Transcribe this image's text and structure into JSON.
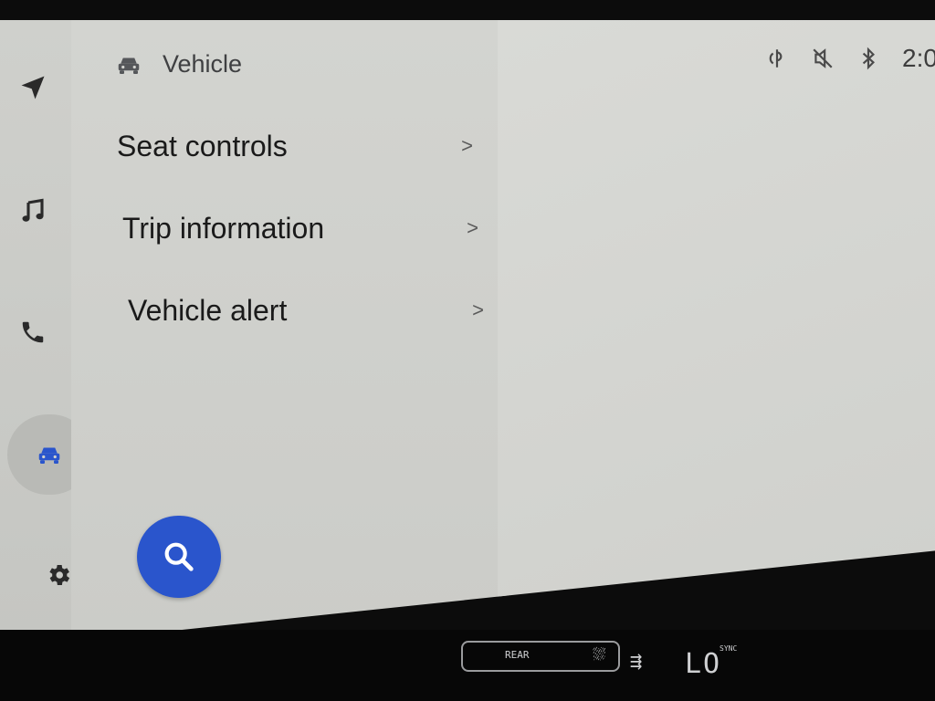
{
  "header": {
    "icon": "car-icon",
    "title": "Vehicle"
  },
  "rail": {
    "items": [
      {
        "name": "navigation",
        "icon": "navigation-arrow-icon"
      },
      {
        "name": "media",
        "icon": "music-note-icon"
      },
      {
        "name": "phone",
        "icon": "phone-icon"
      },
      {
        "name": "vehicle",
        "icon": "car-icon",
        "active": true
      },
      {
        "name": "settings",
        "icon": "gear-icon"
      }
    ]
  },
  "menu": {
    "items": [
      {
        "label": "Seat controls",
        "chevron": ">"
      },
      {
        "label": "Trip information",
        "chevron": ">"
      },
      {
        "label": "Vehicle alert",
        "chevron": ">"
      }
    ]
  },
  "search_button": {
    "icon": "search-icon"
  },
  "status_bar": {
    "icons": [
      "wireless-charging-icon",
      "mute-icon",
      "bluetooth-icon"
    ],
    "clock": "2:0"
  },
  "hvac": {
    "rear_label": "REAR",
    "temp": "LO",
    "sync_label": "SYNC"
  },
  "colors": {
    "accent": "#2a55cc",
    "rail_bg": "#cbccc8",
    "panel_bg": "#d0d1cd",
    "content_bg": "#d6d7d3",
    "text": "#1a1a1a"
  }
}
